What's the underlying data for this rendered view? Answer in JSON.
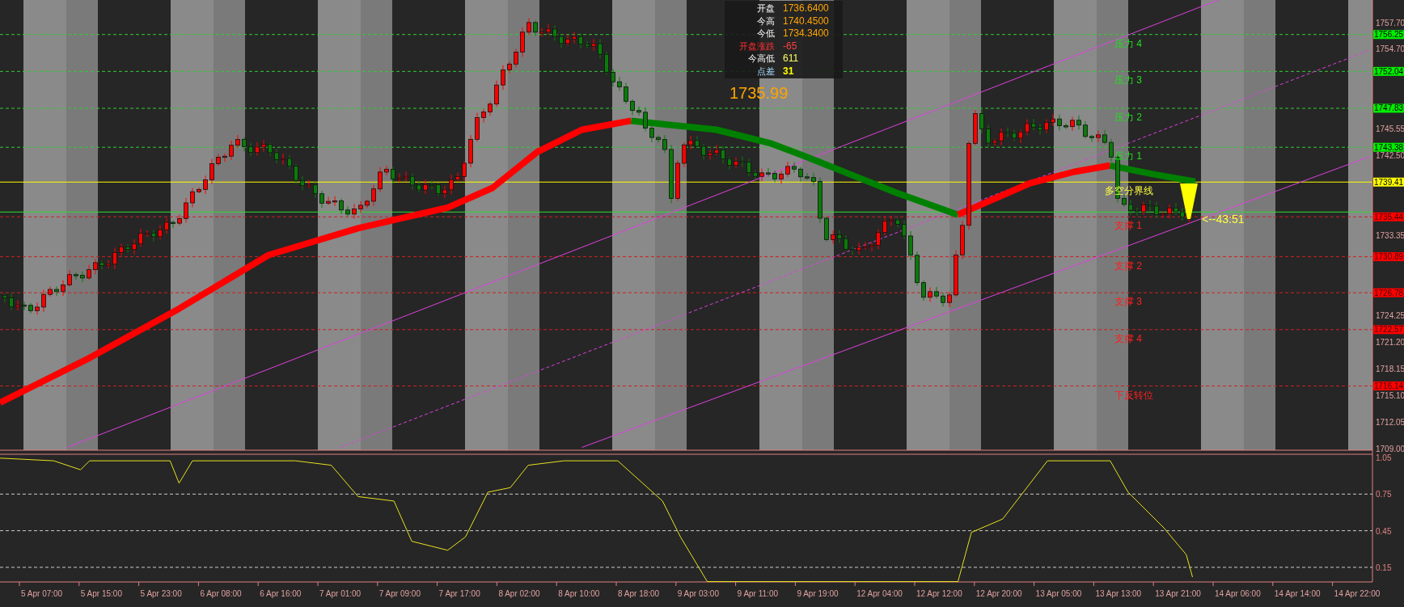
{
  "info_panel": {
    "rows": [
      {
        "label": "开盘",
        "value": "1736.6400",
        "kind": "price"
      },
      {
        "label": "今高",
        "value": "1740.4500",
        "kind": "price"
      },
      {
        "label": "今低",
        "value": "1734.3400",
        "kind": "price"
      },
      {
        "label": "开盘涨跌",
        "value": "-65",
        "kind": "change"
      },
      {
        "label": "今高低",
        "value": "611",
        "kind": "range"
      },
      {
        "label": "点差",
        "value": "31",
        "kind": "spread"
      }
    ],
    "current_price": "1735.99"
  },
  "levels": [
    {
      "label": "压力 4",
      "price_tag": "1756.25",
      "kind": "resistance"
    },
    {
      "label": "压力 3",
      "price_tag": "1752.04",
      "kind": "resistance"
    },
    {
      "label": "压力 2",
      "price_tag": "1747.83",
      "kind": "resistance"
    },
    {
      "label": "压力 1",
      "price_tag": "1743.38",
      "kind": "resistance"
    },
    {
      "label": "多空分界线",
      "price_tag": "1739.41",
      "kind": "divider"
    },
    {
      "label": "支撑 1",
      "price_tag": "1735.44",
      "kind": "support"
    },
    {
      "label": "支撑 2",
      "price_tag": "1730.89",
      "kind": "support"
    },
    {
      "label": "支撑 3",
      "price_tag": "1726.78",
      "kind": "support"
    },
    {
      "label": "支撑 4",
      "price_tag": "1722.57",
      "kind": "support"
    },
    {
      "label": "下反转位",
      "price_tag": "1716.14",
      "kind": "support"
    }
  ],
  "countdown": "<--43:51",
  "price_axis": {
    "ticks": [
      "1757.70",
      "1754.70",
      "1745.55",
      "1742.50",
      "1733.35",
      "1724.25",
      "1721.20",
      "1718.15",
      "1715.10",
      "1712.05",
      "1709.00"
    ]
  },
  "indicator_axis": {
    "ticks": [
      "1.05",
      "0.75",
      "0.45",
      "0.15"
    ]
  },
  "time_axis": {
    "labels": [
      "5 Apr 07:00",
      "5 Apr 15:00",
      "5 Apr 23:00",
      "6 Apr 08:00",
      "6 Apr 16:00",
      "7 Apr 01:00",
      "7 Apr 09:00",
      "7 Apr 17:00",
      "8 Apr 02:00",
      "8 Apr 10:00",
      "8 Apr 18:00",
      "9 Apr 03:00",
      "9 Apr 11:00",
      "9 Apr 19:00",
      "12 Apr 04:00",
      "12 Apr 12:00",
      "12 Apr 20:00",
      "13 Apr 05:00",
      "13 Apr 13:00",
      "13 Apr 21:00",
      "14 Apr 06:00",
      "14 Apr 14:00",
      "14 Apr 22:00"
    ]
  }
}
